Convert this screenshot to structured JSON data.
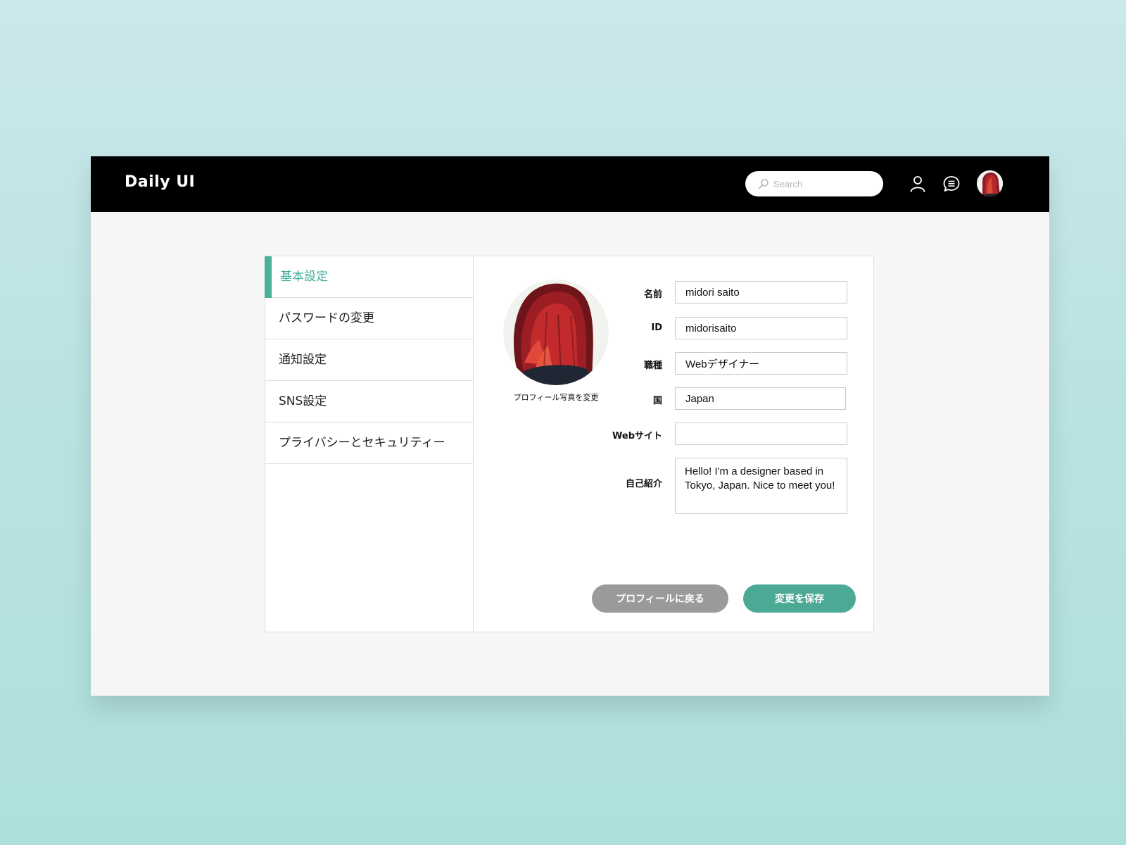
{
  "header": {
    "logo": "Daily UI",
    "search_placeholder": "Search",
    "icons": [
      "search-icon",
      "user-icon",
      "chat-icon"
    ]
  },
  "sidebar": {
    "items": [
      {
        "label": "基本設定",
        "active": true
      },
      {
        "label": "パスワードの変更",
        "active": false
      },
      {
        "label": "通知設定",
        "active": false
      },
      {
        "label": "SNS設定",
        "active": false
      },
      {
        "label": "プライバシーとセキュリティー",
        "active": false
      }
    ]
  },
  "profile": {
    "change_photo": "プロフィール写真を変更",
    "fields": {
      "name": {
        "label": "名前",
        "value": "midori saito"
      },
      "id": {
        "label": "ID",
        "value": "midorisaito"
      },
      "job": {
        "label": "職種",
        "value": "Webデザイナー"
      },
      "country": {
        "label": "国",
        "value": "Japan"
      },
      "website": {
        "label": "Webサイト",
        "value": ""
      },
      "bio": {
        "label": "自己紹介",
        "value": "Hello! I'm a designer based in Tokyo, Japan. Nice to meet you!"
      }
    }
  },
  "actions": {
    "back_label": "プロフィールに戻る",
    "save_label": "変更を保存"
  },
  "colors": {
    "accent": "#4ab09a",
    "header_bg": "#000000",
    "back_button": "#9a9a9a",
    "save_button": "#4ba995"
  }
}
